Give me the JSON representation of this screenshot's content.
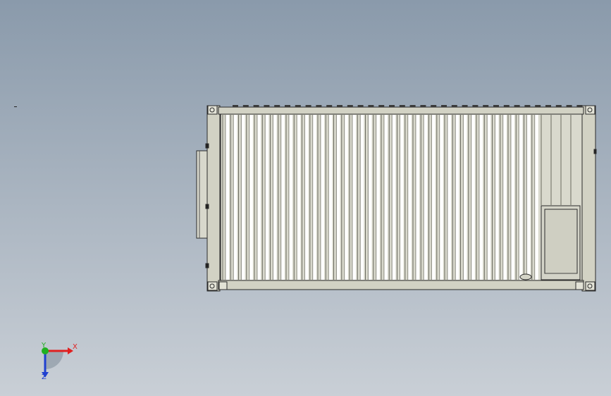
{
  "viewport": {
    "background_top": "#8a9aab",
    "background_bottom": "#c9cfd6"
  },
  "model": {
    "body_color": "#d2d2c4",
    "corrugation_light": "#ffffff",
    "corrugation_dark": "#c4c4b6",
    "outline_color": "#2a2a2a",
    "corrugation_count": 40
  },
  "triad": {
    "x_label": "X",
    "y_label": "Y",
    "z_label": "Z",
    "x_color": "#e02020",
    "y_color": "#20b020",
    "z_color": "#2040d0"
  }
}
